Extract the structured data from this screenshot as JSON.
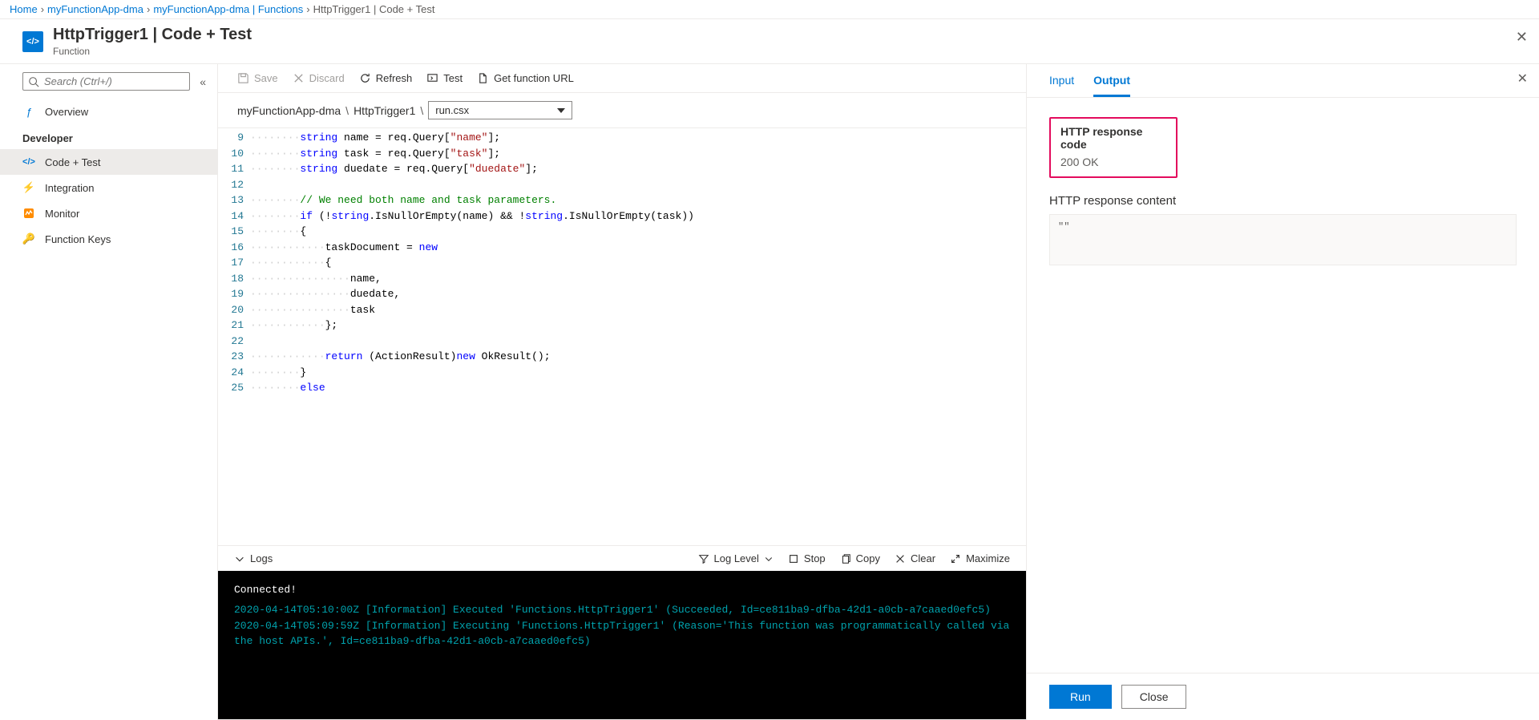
{
  "breadcrumb": {
    "items": [
      "Home",
      "myFunctionApp-dma",
      "myFunctionApp-dma | Functions"
    ],
    "current": "HttpTrigger1 | Code + Test"
  },
  "header": {
    "title": "HttpTrigger1 | Code + Test",
    "subtitle": "Function"
  },
  "sidebar": {
    "search_placeholder": "Search (Ctrl+/)",
    "overview": "Overview",
    "group": "Developer",
    "items": [
      {
        "label": "Code + Test"
      },
      {
        "label": "Integration"
      },
      {
        "label": "Monitor"
      },
      {
        "label": "Function Keys"
      }
    ]
  },
  "toolbar": {
    "save": "Save",
    "discard": "Discard",
    "refresh": "Refresh",
    "test": "Test",
    "get_url": "Get function URL"
  },
  "path": {
    "app": "myFunctionApp-dma",
    "func": "HttpTrigger1",
    "file": "run.csx"
  },
  "code": {
    "first_line": 9,
    "lines": [
      {
        "pre": "········",
        "tokens": [
          [
            "kw",
            "string"
          ],
          [
            "pl",
            " name = req.Query["
          ],
          [
            "str",
            "\"name\""
          ],
          [
            "pl",
            "];"
          ]
        ]
      },
      {
        "pre": "········",
        "tokens": [
          [
            "kw",
            "string"
          ],
          [
            "pl",
            " task = req.Query["
          ],
          [
            "str",
            "\"task\""
          ],
          [
            "pl",
            "];"
          ]
        ]
      },
      {
        "pre": "········",
        "tokens": [
          [
            "kw",
            "string"
          ],
          [
            "pl",
            " duedate = req.Query["
          ],
          [
            "str",
            "\"duedate\""
          ],
          [
            "pl",
            "];"
          ]
        ]
      },
      {
        "pre": "",
        "tokens": []
      },
      {
        "pre": "········",
        "tokens": [
          [
            "cm",
            "// We need both name and task parameters."
          ]
        ]
      },
      {
        "pre": "········",
        "tokens": [
          [
            "kw",
            "if"
          ],
          [
            "pl",
            " (!"
          ],
          [
            "kw",
            "string"
          ],
          [
            "pl",
            ".IsNullOrEmpty(name) && !"
          ],
          [
            "kw",
            "string"
          ],
          [
            "pl",
            ".IsNullOrEmpty(task))"
          ]
        ]
      },
      {
        "pre": "········",
        "tokens": [
          [
            "pl",
            "{"
          ]
        ]
      },
      {
        "pre": "············",
        "tokens": [
          [
            "pl",
            "taskDocument = "
          ],
          [
            "kw",
            "new"
          ]
        ]
      },
      {
        "pre": "············",
        "tokens": [
          [
            "pl",
            "{"
          ]
        ]
      },
      {
        "pre": "················",
        "tokens": [
          [
            "pl",
            "name,"
          ]
        ]
      },
      {
        "pre": "················",
        "tokens": [
          [
            "pl",
            "duedate,"
          ]
        ]
      },
      {
        "pre": "················",
        "tokens": [
          [
            "pl",
            "task"
          ]
        ]
      },
      {
        "pre": "············",
        "tokens": [
          [
            "pl",
            "};"
          ]
        ]
      },
      {
        "pre": "",
        "tokens": []
      },
      {
        "pre": "············",
        "tokens": [
          [
            "kw",
            "return"
          ],
          [
            "pl",
            " (ActionResult)"
          ],
          [
            "kw",
            "new"
          ],
          [
            "pl",
            " OkResult();"
          ]
        ]
      },
      {
        "pre": "········",
        "tokens": [
          [
            "pl",
            "}"
          ]
        ]
      },
      {
        "pre": "········",
        "tokens": [
          [
            "kw",
            "else"
          ]
        ]
      }
    ]
  },
  "logsbar": {
    "logs": "Logs",
    "loglevel": "Log Level",
    "stop": "Stop",
    "copy": "Copy",
    "clear": "Clear",
    "maximize": "Maximize"
  },
  "console": {
    "connected": "Connected!",
    "lines": [
      "2020-04-14T05:10:00Z   [Information]   Executed 'Functions.HttpTrigger1' (Succeeded, Id=ce811ba9-dfba-42d1-a0cb-a7caaed0efc5)",
      "2020-04-14T05:09:59Z   [Information]   Executing 'Functions.HttpTrigger1' (Reason='This function was programmatically called via the host APIs.', Id=ce811ba9-dfba-42d1-a0cb-a7caaed0efc5)"
    ]
  },
  "rp": {
    "tab_input": "Input",
    "tab_output": "Output",
    "code_title": "HTTP response code",
    "code_val": "200 OK",
    "content_title": "HTTP response content",
    "content_val": "\"\"",
    "run": "Run",
    "close": "Close"
  }
}
